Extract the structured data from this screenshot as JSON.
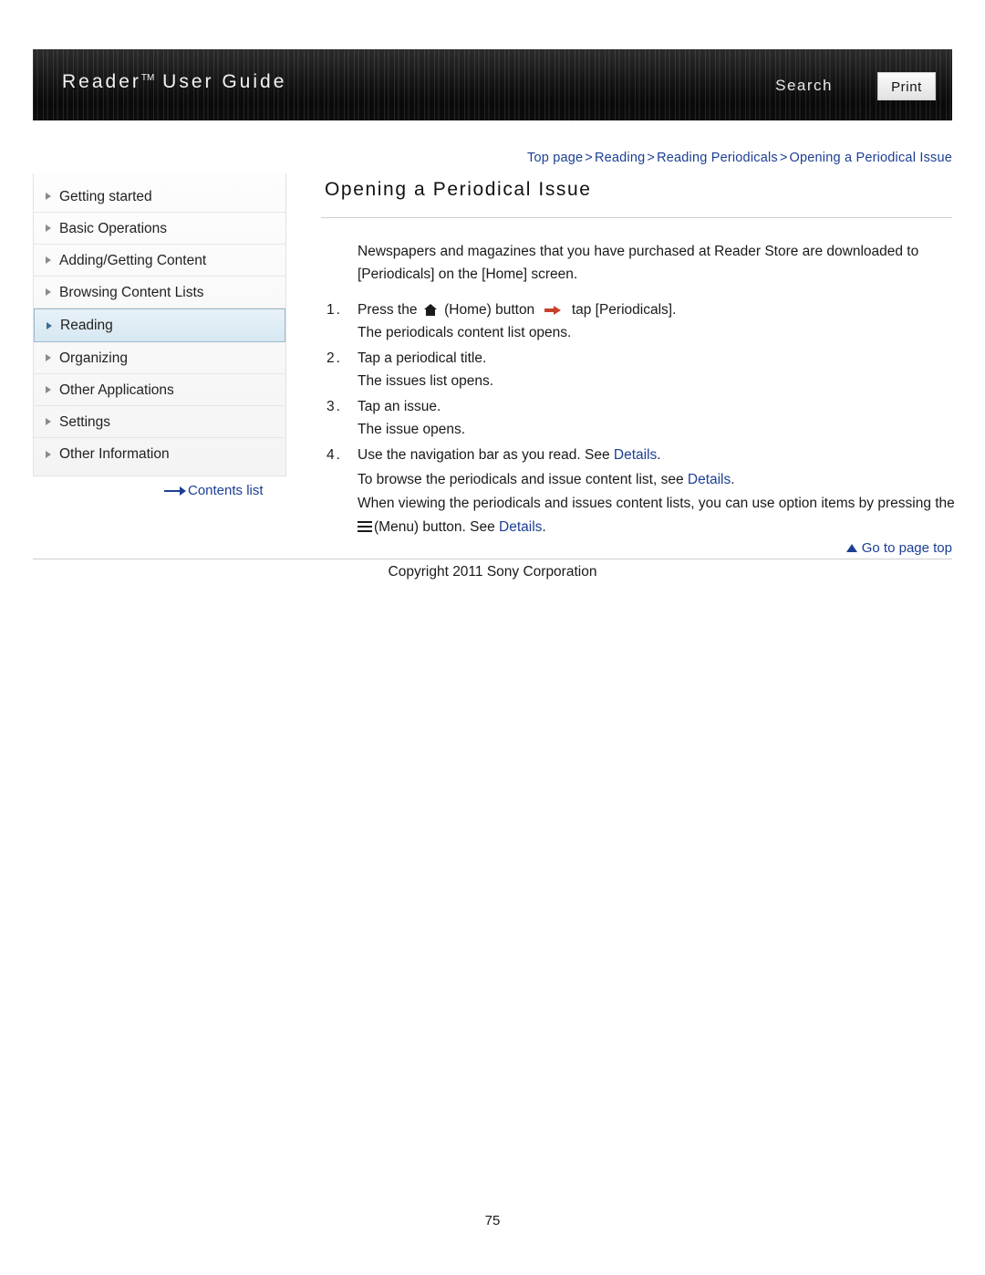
{
  "header": {
    "title_main": "Reader",
    "title_tm": "TM",
    "title_rest": " User Guide",
    "search_label": "Search",
    "print_label": "Print"
  },
  "breadcrumb": {
    "items": [
      "Top page",
      "Reading",
      "Reading Periodicals",
      "Opening a Periodical Issue"
    ],
    "separator": ">"
  },
  "sidebar": {
    "items": [
      {
        "label": "Getting started"
      },
      {
        "label": "Basic Operations"
      },
      {
        "label": "Adding/Getting Content"
      },
      {
        "label": "Browsing Content Lists"
      },
      {
        "label": "Reading"
      },
      {
        "label": "Organizing"
      },
      {
        "label": "Other Applications"
      },
      {
        "label": "Settings"
      },
      {
        "label": "Other Information"
      }
    ],
    "contents_list_label": "Contents list"
  },
  "main": {
    "page_title": "Opening a Periodical Issue",
    "intro": "Newspapers and magazines that you have purchased at Reader Store are downloaded to [Periodicals] on the [Home] screen.",
    "steps": [
      {
        "num": "1.",
        "text_before_home": "Press the",
        "text_after_home": "(Home) button",
        "text_after_arrow": "tap [Periodicals].",
        "sub": "The periodicals content list opens."
      },
      {
        "num": "2.",
        "text": "Tap a periodical title.",
        "sub": "The issues list opens."
      },
      {
        "num": "3.",
        "text": "Tap an issue.",
        "sub": "The issue opens."
      },
      {
        "num": "4.",
        "text": "Use the navigation bar as you read. See",
        "link": "Details",
        "text_end": "."
      }
    ],
    "para_browse_before": "To browse the periodicals and issue content list, see",
    "para_browse_link": "Details",
    "para_browse_after": ".",
    "para_option_before": "When viewing the periodicals and issues content lists, you can use option items by pressing the",
    "para_option_menu": "(Menu) button. See",
    "para_option_link": "Details",
    "para_option_after": "."
  },
  "goto_top": {
    "label": "Go to page top"
  },
  "footer": {
    "copyright": "Copyright 2011 Sony Corporation",
    "page_number": "75"
  },
  "colors": {
    "link": "#1c3f94",
    "accent_arrow": "#c8412b",
    "active_sidebar": "#d7e8f2"
  }
}
